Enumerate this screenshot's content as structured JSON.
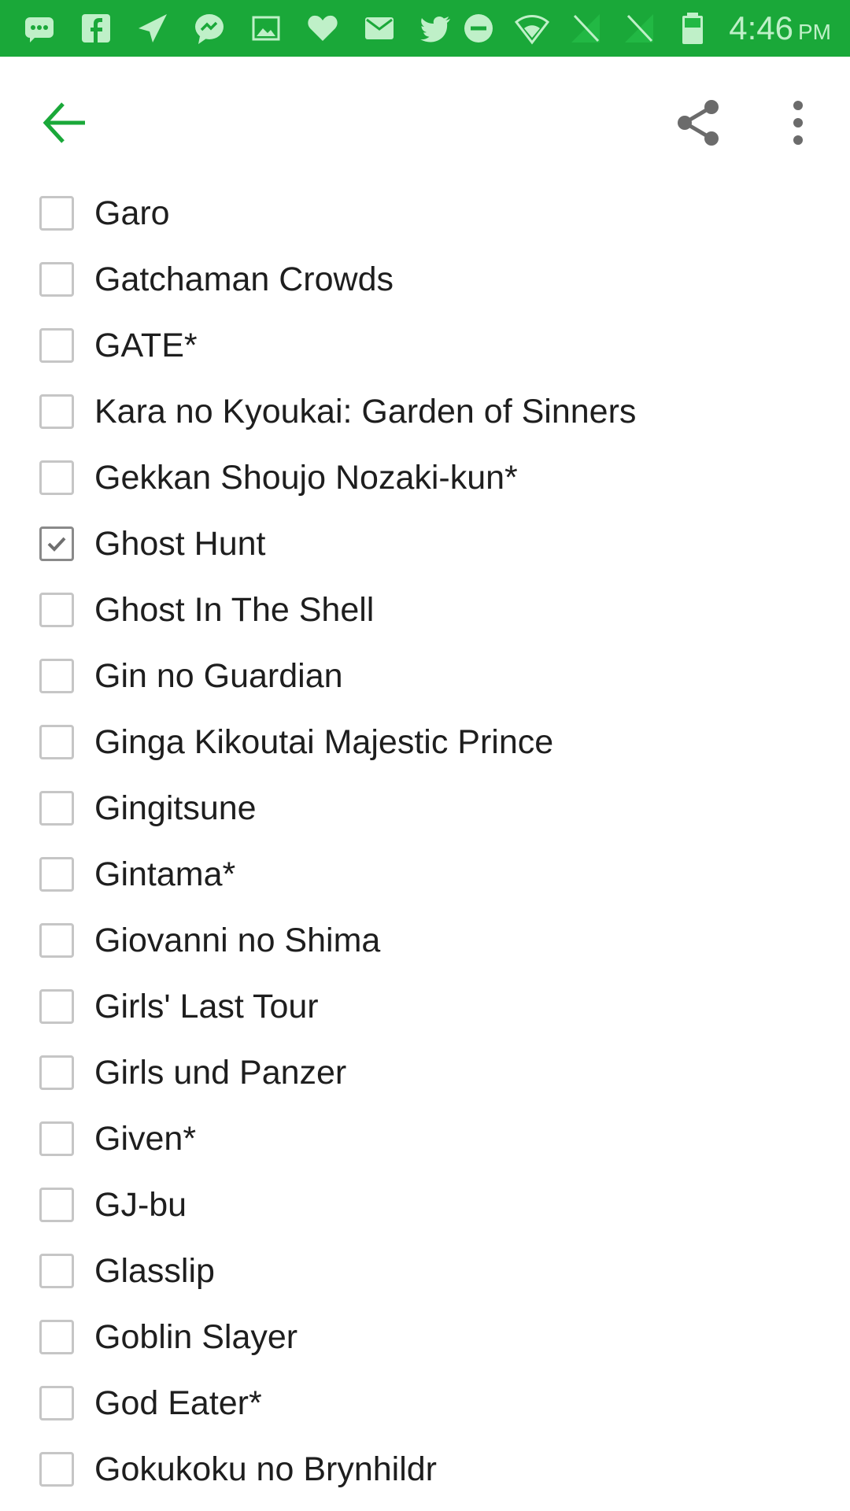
{
  "status_bar": {
    "time": "4:46",
    "ampm": "PM",
    "background_color": "#1aa839",
    "notification_icons": [
      "message-icon",
      "facebook-icon",
      "send-icon",
      "messenger-icon",
      "image-icon",
      "heart-icon",
      "email-icon",
      "twitter-icon"
    ],
    "system_icons": [
      "do-not-disturb-icon",
      "wifi-icon",
      "signal-icon",
      "signal-icon-2",
      "battery-icon"
    ]
  },
  "toolbar": {
    "accent_color": "#1aa839",
    "icons": [
      "back-arrow-icon",
      "share-icon",
      "more-vert-icon"
    ]
  },
  "checklist": {
    "items": [
      {
        "label": "Garo",
        "checked": false
      },
      {
        "label": "Gatchaman Crowds",
        "checked": false
      },
      {
        "label": "GATE*",
        "checked": false
      },
      {
        "label": "Kara no Kyoukai: Garden of Sinners",
        "checked": false
      },
      {
        "label": "Gekkan Shoujo Nozaki-kun*",
        "checked": false
      },
      {
        "label": "Ghost Hunt",
        "checked": true
      },
      {
        "label": "Ghost In The Shell",
        "checked": false
      },
      {
        "label": "Gin no Guardian",
        "checked": false
      },
      {
        "label": "Ginga Kikoutai Majestic Prince",
        "checked": false
      },
      {
        "label": "Gingitsune",
        "checked": false
      },
      {
        "label": "Gintama*",
        "checked": false
      },
      {
        "label": "Giovanni no Shima",
        "checked": false
      },
      {
        "label": "Girls' Last Tour",
        "checked": false
      },
      {
        "label": "Girls und Panzer",
        "checked": false
      },
      {
        "label": "Given*",
        "checked": false
      },
      {
        "label": "GJ-bu",
        "checked": false
      },
      {
        "label": "Glasslip",
        "checked": false
      },
      {
        "label": "Goblin Slayer",
        "checked": false
      },
      {
        "label": "God Eater*",
        "checked": false
      },
      {
        "label": "Gokukoku no Brynhildr",
        "checked": false
      }
    ]
  }
}
